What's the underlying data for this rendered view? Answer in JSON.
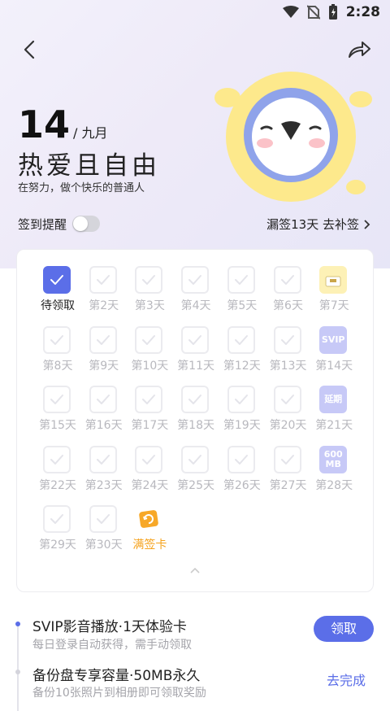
{
  "status_bar": {
    "time": "2:28"
  },
  "header": {
    "day": "14",
    "month": "/ 九月",
    "motto": "热爱且自由",
    "subtitle": "在努力，做个快乐的普通人"
  },
  "reminder": {
    "label": "签到提醒",
    "enabled": false
  },
  "makeup": {
    "text": "漏签13天 去补签"
  },
  "calendar": {
    "days": [
      {
        "label": "待领取",
        "state": "active"
      },
      {
        "label": "第2天",
        "state": "normal"
      },
      {
        "label": "第3天",
        "state": "normal"
      },
      {
        "label": "第4天",
        "state": "normal"
      },
      {
        "label": "第5天",
        "state": "normal"
      },
      {
        "label": "第6天",
        "state": "normal"
      },
      {
        "label": "第7天",
        "state": "gift",
        "badge": ""
      },
      {
        "label": "第8天",
        "state": "normal"
      },
      {
        "label": "第9天",
        "state": "normal"
      },
      {
        "label": "第10天",
        "state": "normal"
      },
      {
        "label": "第11天",
        "state": "normal"
      },
      {
        "label": "第12天",
        "state": "normal"
      },
      {
        "label": "第13天",
        "state": "normal"
      },
      {
        "label": "第14天",
        "state": "reward",
        "badge": "SVIP"
      },
      {
        "label": "第15天",
        "state": "normal"
      },
      {
        "label": "第16天",
        "state": "normal"
      },
      {
        "label": "第17天",
        "state": "normal"
      },
      {
        "label": "第18天",
        "state": "normal"
      },
      {
        "label": "第19天",
        "state": "normal"
      },
      {
        "label": "第20天",
        "state": "normal"
      },
      {
        "label": "第21天",
        "state": "reward",
        "badge": "延期"
      },
      {
        "label": "第22天",
        "state": "normal"
      },
      {
        "label": "第23天",
        "state": "normal"
      },
      {
        "label": "第24天",
        "state": "normal"
      },
      {
        "label": "第25天",
        "state": "normal"
      },
      {
        "label": "第26天",
        "state": "normal"
      },
      {
        "label": "第27天",
        "state": "normal"
      },
      {
        "label": "第28天",
        "state": "reward",
        "badge": "600\nMB"
      },
      {
        "label": "第29天",
        "state": "normal"
      },
      {
        "label": "第30天",
        "state": "normal"
      },
      {
        "label": "满签卡",
        "state": "special"
      }
    ]
  },
  "tasks": [
    {
      "title": "SVIP影音播放·1天体验卡",
      "desc": "每日登录自动获得，需手动领取",
      "action": "领取"
    },
    {
      "title": "备份盘专享容量·50MB永久",
      "desc": "备份10张照片到相册即可领取奖励",
      "action": "去完成"
    }
  ],
  "colors": {
    "accent": "#5b6ee8",
    "orange": "#f5a21c",
    "muted": "#b8b8be"
  }
}
